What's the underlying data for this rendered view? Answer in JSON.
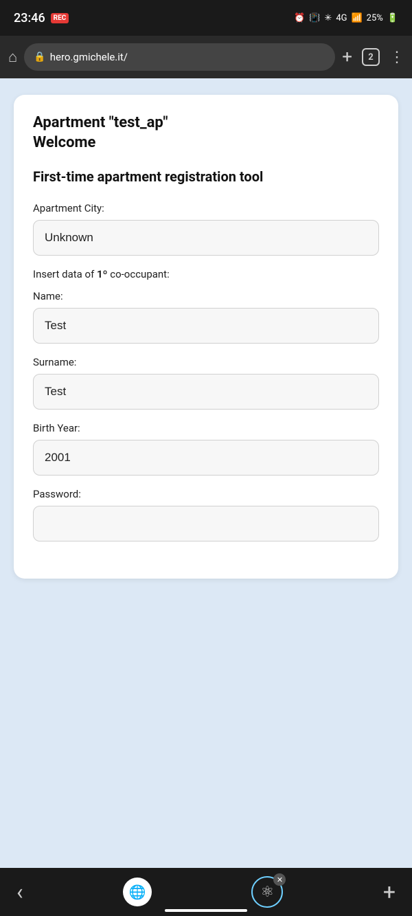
{
  "status_bar": {
    "time": "23:46",
    "battery": "25%",
    "rec_label": "REC"
  },
  "browser": {
    "url": "hero.gmichele.it/",
    "tabs_count": "2",
    "plus_label": "+",
    "menu_label": "⋮"
  },
  "page": {
    "apartment_title": "Apartment \"test_ap\"",
    "welcome_title": "Welcome",
    "section_title": "First-time apartment registration tool",
    "apartment_city_label": "Apartment City:",
    "apartment_city_value": "Unknown",
    "insert_label_prefix": "Insert data of ",
    "insert_label_ordinal": "1º",
    "insert_label_suffix": " co-occupant:",
    "name_label": "Name:",
    "name_value": "Test",
    "surname_label": "Surname:",
    "surname_value": "Test",
    "birth_year_label": "Birth Year:",
    "birth_year_value": "2001",
    "password_label": "Password:"
  },
  "bottom_nav": {
    "back_label": "‹",
    "plus_label": "+"
  }
}
